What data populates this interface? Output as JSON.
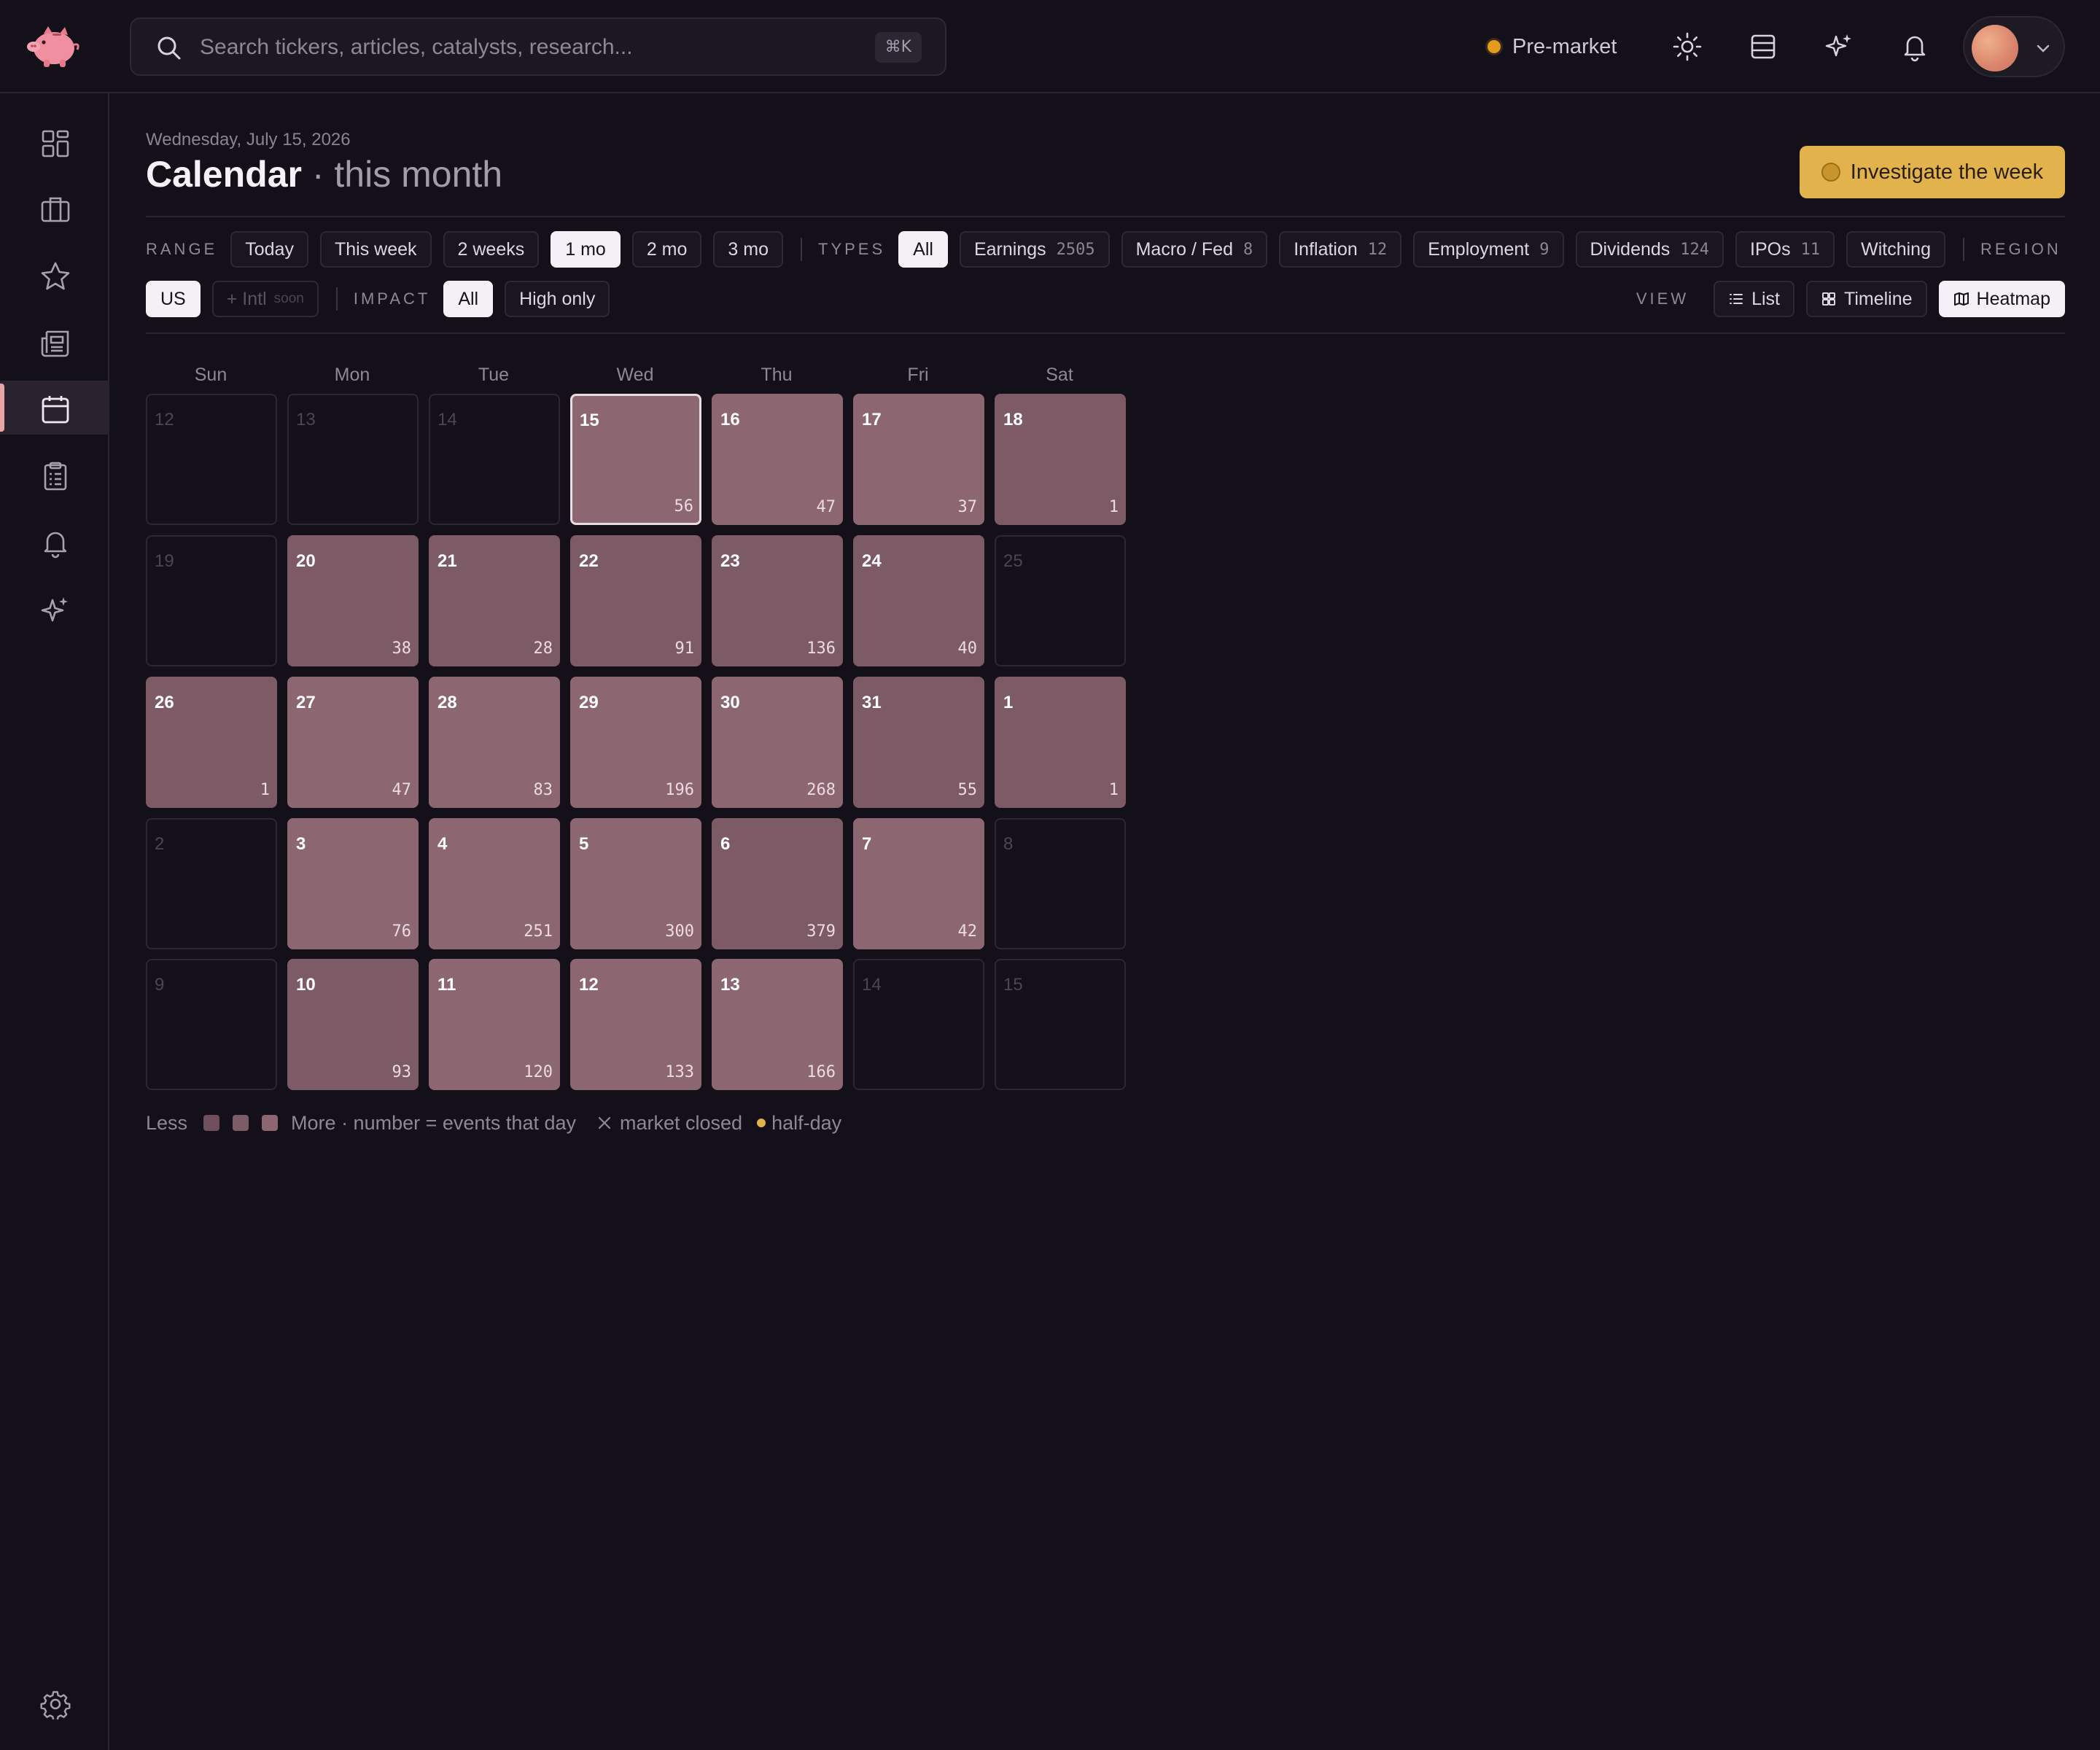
{
  "topbar": {
    "search_placeholder": "Search tickers, articles, catalysts, research...",
    "search_shortcut": "⌘K",
    "market_status": "Pre-market",
    "status_color": "#e49b1c"
  },
  "sidebar": {
    "items": [
      "dashboard-icon",
      "portfolio-icon",
      "watchlist-icon",
      "news-icon",
      "calendar-icon",
      "research-icon",
      "alerts-icon",
      "ai-icon"
    ],
    "active": "calendar-icon",
    "footer": "settings-icon"
  },
  "header": {
    "date": "Wednesday, July 15, 2026",
    "title": "Calendar",
    "subtitle": "· this month",
    "investigate_label": "Investigate the week"
  },
  "filters": {
    "range_label": "RANGE",
    "range": [
      "Today",
      "This week",
      "2 weeks",
      "1 mo",
      "2 mo",
      "3 mo"
    ],
    "range_selected": "1 mo",
    "types_label": "TYPES",
    "types": [
      {
        "label": "All",
        "count": ""
      },
      {
        "label": "Earnings",
        "count": "2505"
      },
      {
        "label": "Macro / Fed",
        "count": "8"
      },
      {
        "label": "Inflation",
        "count": "12"
      },
      {
        "label": "Employment",
        "count": "9"
      },
      {
        "label": "Dividends",
        "count": "124"
      },
      {
        "label": "IPOs",
        "count": "11"
      },
      {
        "label": "Witching",
        "count": ""
      }
    ],
    "types_selected": "All",
    "region_label": "REGION",
    "region": {
      "us": "US",
      "intl": "+ Intl",
      "intl_badge": "soon"
    },
    "impact_label": "IMPACT",
    "impact": [
      "All",
      "High only"
    ],
    "impact_selected": "All",
    "view_label": "VIEW",
    "view": [
      "List",
      "Timeline",
      "Heatmap"
    ],
    "view_selected": "Heatmap"
  },
  "calendar": {
    "weekdays": [
      "Sun",
      "Mon",
      "Tue",
      "Wed",
      "Thu",
      "Fri",
      "Sat"
    ],
    "today": "15",
    "heat_colors": [
      "#6f4f5c",
      "#7c5a66",
      "#8c6670"
    ],
    "weeks": [
      [
        {
          "day": "12"
        },
        {
          "day": "13"
        },
        {
          "day": "14"
        },
        {
          "day": "15",
          "events": "56",
          "heat": 2
        },
        {
          "day": "16",
          "events": "47",
          "heat": 2
        },
        {
          "day": "17",
          "events": "37",
          "heat": 2
        },
        {
          "day": "18",
          "events": "1",
          "heat": 1
        }
      ],
      [
        {
          "day": "19"
        },
        {
          "day": "20",
          "events": "38",
          "heat": 1
        },
        {
          "day": "21",
          "events": "28",
          "heat": 1
        },
        {
          "day": "22",
          "events": "91",
          "heat": 1
        },
        {
          "day": "23",
          "events": "136",
          "heat": 1
        },
        {
          "day": "24",
          "events": "40",
          "heat": 1
        },
        {
          "day": "25"
        }
      ],
      [
        {
          "day": "26",
          "events": "1",
          "heat": 1
        },
        {
          "day": "27",
          "events": "47",
          "heat": 2
        },
        {
          "day": "28",
          "events": "83",
          "heat": 2
        },
        {
          "day": "29",
          "events": "196",
          "heat": 2
        },
        {
          "day": "30",
          "events": "268",
          "heat": 2
        },
        {
          "day": "31",
          "events": "55",
          "heat": 1
        },
        {
          "day": "1",
          "events": "1",
          "heat": 1
        }
      ],
      [
        {
          "day": "2"
        },
        {
          "day": "3",
          "events": "76",
          "heat": 2
        },
        {
          "day": "4",
          "events": "251",
          "heat": 2
        },
        {
          "day": "5",
          "events": "300",
          "heat": 2
        },
        {
          "day": "6",
          "events": "379",
          "heat": 1
        },
        {
          "day": "7",
          "events": "42",
          "heat": 2
        },
        {
          "day": "8"
        }
      ],
      [
        {
          "day": "9"
        },
        {
          "day": "10",
          "events": "93",
          "heat": 1
        },
        {
          "day": "11",
          "events": "120",
          "heat": 2
        },
        {
          "day": "12",
          "events": "133",
          "heat": 2
        },
        {
          "day": "13",
          "events": "166",
          "heat": 2
        },
        {
          "day": "14"
        },
        {
          "day": "15"
        }
      ]
    ]
  },
  "legend": {
    "less": "Less",
    "more": "More · number = events that day",
    "closed": "market closed",
    "half_day": "half-day"
  }
}
